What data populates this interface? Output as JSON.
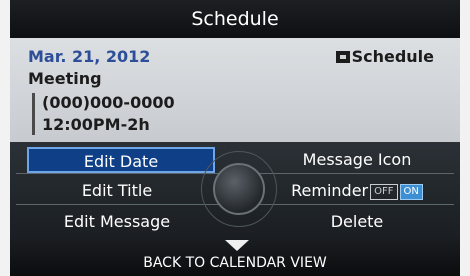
{
  "title": "Schedule",
  "entry": {
    "date": "Mar. 21, 2012",
    "tag_label": "Schedule",
    "event": "Meeting",
    "phone": "(000)000-0000",
    "time": "12:00PM-2h"
  },
  "menu": {
    "edit_date": "Edit Date",
    "edit_title": "Edit Title",
    "edit_message": "Edit Message",
    "message_icon": "Message Icon",
    "reminder": "Reminder",
    "reminder_off": "OFF",
    "reminder_on": "ON",
    "delete": "Delete"
  },
  "footer": {
    "back_label": "BACK TO CALENDAR VIEW"
  },
  "colors": {
    "selected_bg": "#0f3f86",
    "selected_border": "#6ea6e6",
    "date_text": "#2d4f98",
    "on_toggle": "#3d8fd4"
  }
}
